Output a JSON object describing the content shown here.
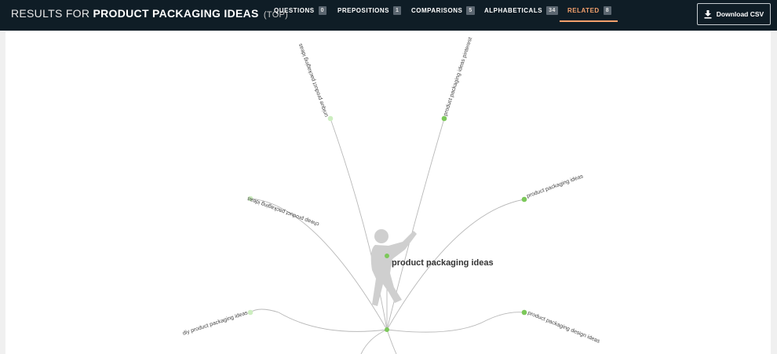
{
  "header": {
    "title_prefix": "RESULTS FOR",
    "title_keyword": "PRODUCT PACKAGING IDEAS",
    "title_modifier": "(TOP)"
  },
  "tabs": [
    {
      "label": "QUESTIONS",
      "count": "0"
    },
    {
      "label": "PREPOSITIONS",
      "count": "1"
    },
    {
      "label": "COMPARISONS",
      "count": "5"
    },
    {
      "label": "ALPHABETICALS",
      "count": "34"
    },
    {
      "label": "RELATED",
      "count": "8",
      "active": true
    }
  ],
  "download_button": {
    "label": "Download CSV",
    "icon": "download-icon"
  },
  "colors": {
    "topbar": "#0f1d26",
    "accent": "#f3a06c",
    "node_green": "#7cc85a",
    "node_light_green": "#cdeec0"
  },
  "graph": {
    "center_label": "product packaging ideas",
    "mascot_icon": "silhouette-person-icon",
    "nodes": [
      {
        "label": "unique product packaging ideas"
      },
      {
        "label": "product packaging ideas pinterest"
      },
      {
        "label": "cheap product packaging ideas"
      },
      {
        "label": "product packaging ideas"
      },
      {
        "label": "diy product packaging ideas"
      },
      {
        "label": "product packaging design ideas"
      }
    ]
  }
}
